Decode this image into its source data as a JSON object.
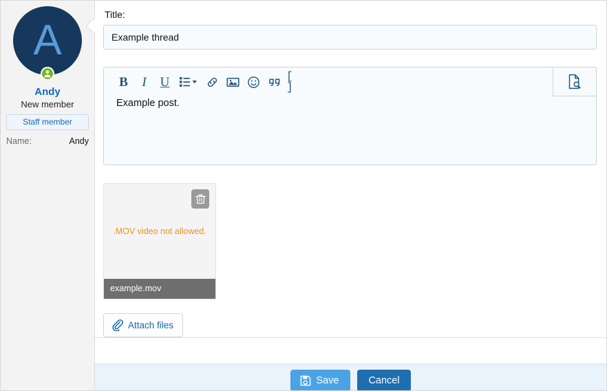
{
  "sidebar": {
    "avatar_letter": "A",
    "avatar_bg": "#16385c",
    "avatar_fg": "#5a9bd8",
    "status_icon": "online-user-icon",
    "status_color": "#74b816",
    "user_name": "Andy",
    "user_title": "New member",
    "staff_badge": "Staff member",
    "fields": [
      {
        "key": "Name:",
        "value": "Andy"
      }
    ]
  },
  "form": {
    "title_label": "Title:",
    "title_value": "Example thread",
    "title_placeholder": "Title"
  },
  "editor": {
    "body_text": "Example post.",
    "toolbar": [
      {
        "name": "bold-icon",
        "glyph": "B"
      },
      {
        "name": "italic-icon",
        "glyph": "I"
      },
      {
        "name": "underline-icon",
        "glyph": "U"
      },
      {
        "name": "list-icon",
        "glyph": "list"
      },
      {
        "name": "link-icon",
        "glyph": "link"
      },
      {
        "name": "image-icon",
        "glyph": "image"
      },
      {
        "name": "emoji-icon",
        "glyph": "smiley"
      },
      {
        "name": "quote-icon",
        "glyph": "quote"
      },
      {
        "name": "code-icon",
        "glyph": "[ ]"
      }
    ],
    "preview_icon": "document-preview-icon"
  },
  "attachment": {
    "message": ".MOV video not allowed.",
    "message_color": "#f2921d",
    "filename": "example.mov",
    "delete_icon": "trash-icon",
    "attach_label": "Attach files",
    "attach_icon": "paperclip-icon"
  },
  "footer": {
    "save_label": "Save",
    "save_icon": "floppy-save-icon",
    "save_color": "#4ba3e3",
    "cancel_label": "Cancel",
    "cancel_color": "#1d6fb0"
  }
}
